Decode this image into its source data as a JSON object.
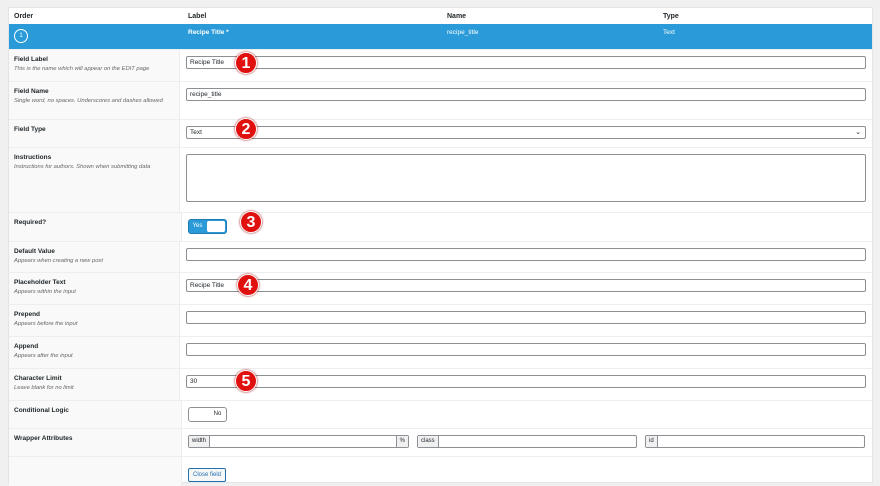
{
  "header": {
    "order": "Order",
    "label": "Label",
    "name": "Name",
    "type": "Type"
  },
  "field": {
    "order": "1",
    "label": "Recipe Title *",
    "name": "recipe_title",
    "type": "Text"
  },
  "rows": {
    "field_label": {
      "title": "Field Label",
      "desc": "This is the name which will appear on the EDIT page",
      "value": "Recipe Title"
    },
    "field_name": {
      "title": "Field Name",
      "desc": "Single word, no spaces. Underscores and dashes allowed",
      "value": "recipe_title"
    },
    "field_type": {
      "title": "Field Type",
      "value": "Text"
    },
    "instructions": {
      "title": "Instructions",
      "desc": "Instructions for authors. Shown when submitting data",
      "value": ""
    },
    "required": {
      "title": "Required?",
      "toggle": "Yes"
    },
    "default_value": {
      "title": "Default Value",
      "desc": "Appears when creating a new post",
      "value": ""
    },
    "placeholder": {
      "title": "Placeholder Text",
      "desc": "Appears within the input",
      "value": "Recipe Title"
    },
    "prepend": {
      "title": "Prepend",
      "desc": "Appears before the input",
      "value": ""
    },
    "append": {
      "title": "Append",
      "desc": "Appears after the input",
      "value": ""
    },
    "char_limit": {
      "title": "Character Limit",
      "desc": "Leave blank for no limit",
      "value": "30"
    },
    "conditional": {
      "title": "Conditional Logic",
      "toggle": "No"
    },
    "wrapper": {
      "title": "Wrapper Attributes",
      "width": "width",
      "percent": "%",
      "class": "class",
      "id": "id"
    }
  },
  "close_button": "Close field",
  "annotations": [
    "1",
    "2",
    "3",
    "4",
    "5"
  ]
}
